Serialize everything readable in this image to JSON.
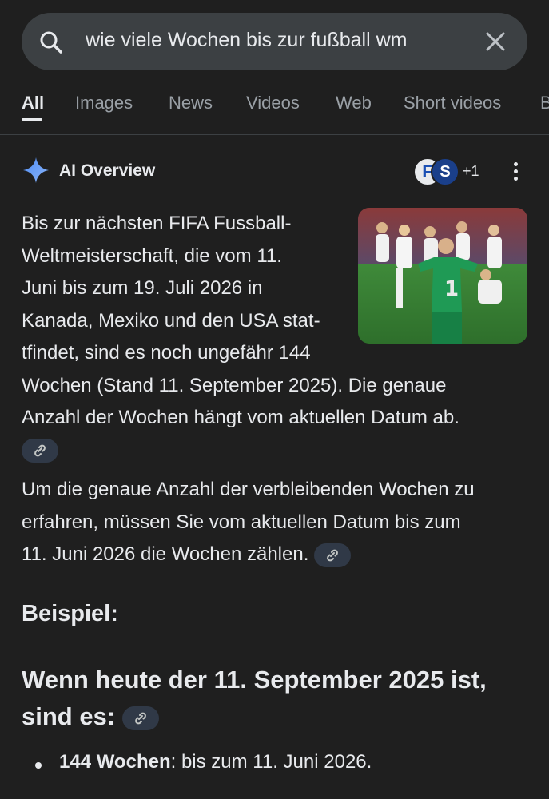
{
  "search": {
    "query": "wie viele Wochen bis zur fußball wm",
    "search_icon": "search-icon",
    "clear_icon": "close-icon"
  },
  "tabs": [
    {
      "label": "All",
      "active": true
    },
    {
      "label": "Images"
    },
    {
      "label": "News"
    },
    {
      "label": "Videos"
    },
    {
      "label": "Web"
    },
    {
      "label": "Short videos"
    },
    {
      "label": "B"
    }
  ],
  "ai_overview": {
    "title": "AI Overview",
    "icon": "sparkle-icon",
    "sources": {
      "avatar1": "F",
      "avatar2": "S",
      "more": "+1"
    },
    "para1_lines": [
      "Bis zur nächsten FIFA Fussball-",
      "Weltmeisterschaft, die vom 11.",
      "Juni bis zum 19. Juli 2026 in",
      "Kanada, Mexiko und den USA stat-",
      "tfindet, sind es noch ungefähr 144",
      "Wochen (Stand 11. September 2025). Die genaue",
      "Anzahl der Wochen hängt vom aktuellen Datum ab."
    ],
    "para2_lines": [
      "Um die genaue Anzahl der verbleibenden Wochen zu",
      "erfahren, müssen Sie vom aktuellen Datum bis zum",
      "11. Juni 2026 die Wochen zählen."
    ],
    "example_heading": "Beispiel:",
    "subheading_lines": [
      "Wenn heute der 11. September 2025 ist,",
      "sind es:"
    ],
    "bullet_bold": "144 Wochen",
    "bullet_rest": ": bis zum 11. Juni 2026.",
    "link_icon": "link-icon"
  },
  "colors": {
    "background": "#1f1f1f",
    "search_bg": "#3c4043",
    "chip_bg": "#303947",
    "text": "#e8eaed",
    "muted": "#9aa0a6"
  }
}
